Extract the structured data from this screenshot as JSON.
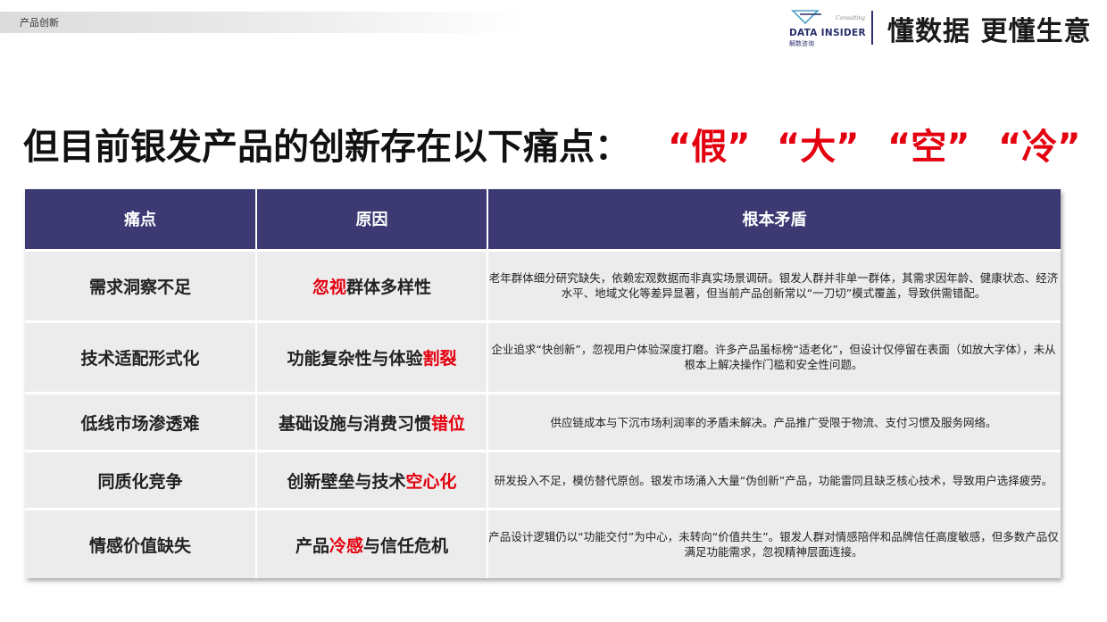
{
  "header": {
    "section_label": "产品创新",
    "logo": {
      "name": "DATA INSIDER",
      "subtitle": "解数咨询",
      "consulting": "Consulting"
    },
    "slogan": "懂数据 更懂生意"
  },
  "headline": {
    "text": "但目前银发产品的创新存在以下痛点：",
    "keywords": [
      "“假”",
      "“大”",
      "“空”",
      "“冷”"
    ],
    "keyword_color": "#e4000f"
  },
  "table": {
    "header_color": "#3c3973",
    "columns": [
      "痛点",
      "原因",
      "根本矛盾"
    ],
    "rows": [
      {
        "pain": "需求洞察不足",
        "cause_pre": "",
        "cause_hl": "忽视",
        "cause_post": "群体多样性",
        "contradiction": "老年群体细分研究缺失，依赖宏观数据而非真实场景调研。银发人群并非单一群体，其需求因年龄、健康状态、经济水平、地域文化等差异显著，但当前产品创新常以“一刀切”模式覆盖，导致供需错配。"
      },
      {
        "pain": "技术适配形式化",
        "cause_pre": "功能复杂性与体验",
        "cause_hl": "割裂",
        "cause_post": "",
        "contradiction": "企业追求“快创新”，忽视用户体验深度打磨。许多产品虽标榜“适老化”，但设计仅停留在表面（如放大字体），未从根本上解决操作门槛和安全性问题。"
      },
      {
        "pain": "低线市场渗透难",
        "cause_pre": "基础设施与消费习惯",
        "cause_hl": "错位",
        "cause_post": "",
        "contradiction": "供应链成本与下沉市场利润率的矛盾未解决。产品推广受限于物流、支付习惯及服务网络。"
      },
      {
        "pain": "同质化竞争",
        "cause_pre": "创新壁垒与技术",
        "cause_hl": "空心化",
        "cause_post": "",
        "contradiction": "研发投入不足，模仿替代原创。银发市场涌入大量“伪创新”产品，功能雷同且缺乏核心技术，导致用户选择疲劳。"
      },
      {
        "pain": "情感价值缺失",
        "cause_pre": "产品",
        "cause_hl": "冷感",
        "cause_post": "与信任危机",
        "contradiction": "产品设计逻辑仍以“功能交付”为中心，未转向“价值共生”。银发人群对情感陪伴和品牌信任高度敏感，但多数产品仅满足功能需求，忽视精神层面连接。"
      }
    ]
  }
}
